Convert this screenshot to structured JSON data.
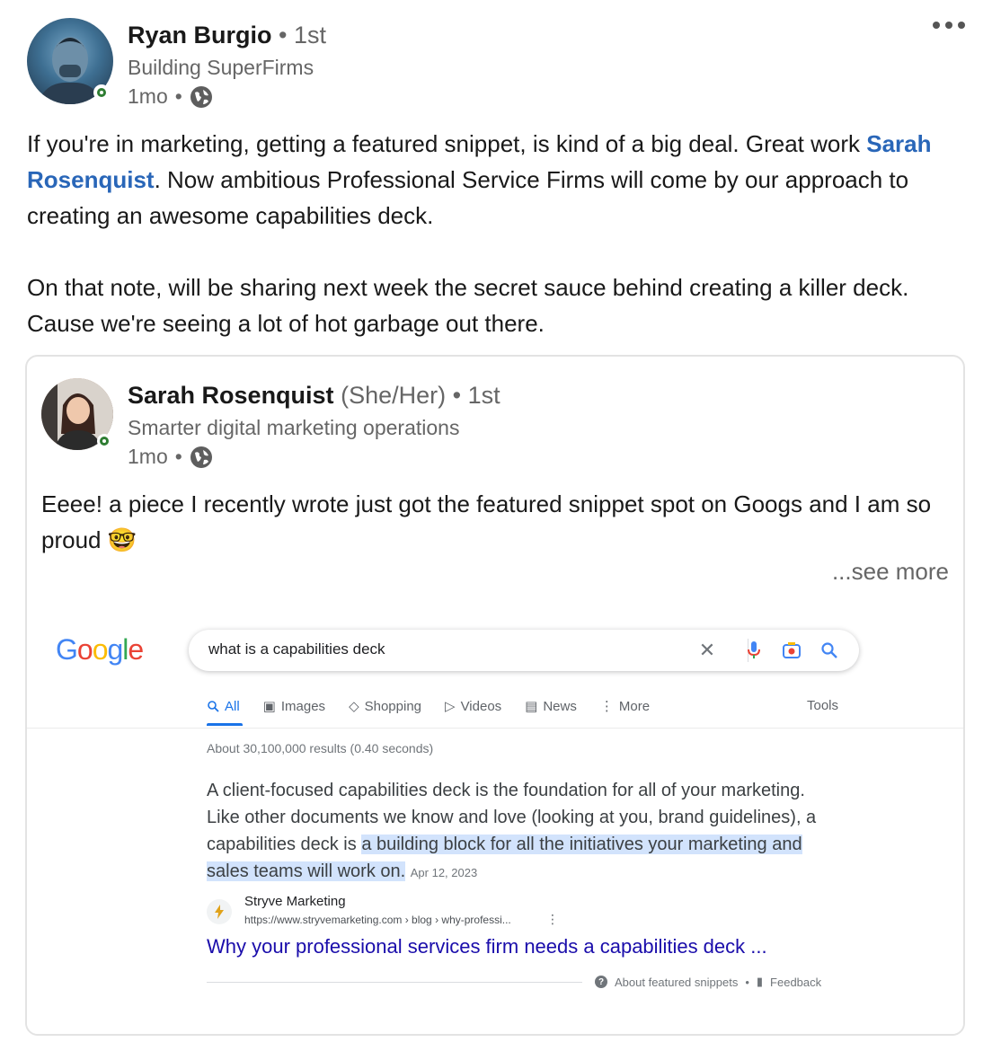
{
  "post": {
    "author": {
      "name": "Ryan Burgio",
      "degree": "• 1st",
      "headline": "Building SuperFirms",
      "time": "1mo",
      "separator": "•"
    },
    "body": {
      "p1_a": "If you're in marketing, getting a featured snippet, is kind of a big deal. Great work ",
      "mention": "Sarah Rosenquist",
      "p1_b": ". Now ambitious Professional Service Firms will come by our approach to creating an awesome capabilities deck.",
      "p2": "On that note, will be sharing next week the secret sauce behind creating a killer deck. Cause we're seeing a lot of hot garbage out there."
    }
  },
  "shared": {
    "author": {
      "name": "Sarah Rosenquist",
      "pronouns": "(She/Her)",
      "degree": "• 1st",
      "headline": "Smarter digital marketing operations",
      "time": "1mo",
      "separator": "•"
    },
    "body": "Eeee! a piece I recently wrote just got the featured snippet spot on Googs and I am so proud",
    "emoji": "🤓",
    "see_more": "...see more"
  },
  "google": {
    "logo": "Google",
    "query": "what is a capabilities deck",
    "tabs": [
      "All",
      "Images",
      "Shopping",
      "Videos",
      "News",
      "More"
    ],
    "tools": "Tools",
    "stats": "About 30,100,000 results (0.40 seconds)",
    "snippet_plain": "A client-focused capabilities deck is the foundation for all of your marketing. Like other documents we know and love (looking at you, brand guidelines), a capabilities deck is ",
    "snippet_highlight": "a building block for all the initiatives your marketing and sales teams will work on.",
    "snippet_date": "Apr 12, 2023",
    "source_name": "Stryve Marketing",
    "source_url": "https://www.stryvemarketing.com › blog › why-professi...",
    "result_title": "Why your professional services firm needs a capabilities deck ...",
    "about_snippets": "About featured snippets",
    "feedback": "Feedback",
    "dot": "•"
  },
  "colors": {
    "mention": "#2966b8",
    "google_blue": "#4285F4",
    "google_red": "#EA4335",
    "google_yellow": "#FBBC05",
    "google_green": "#34A853",
    "link_title": "#1a0dab",
    "highlight": "#d2e3fc"
  }
}
